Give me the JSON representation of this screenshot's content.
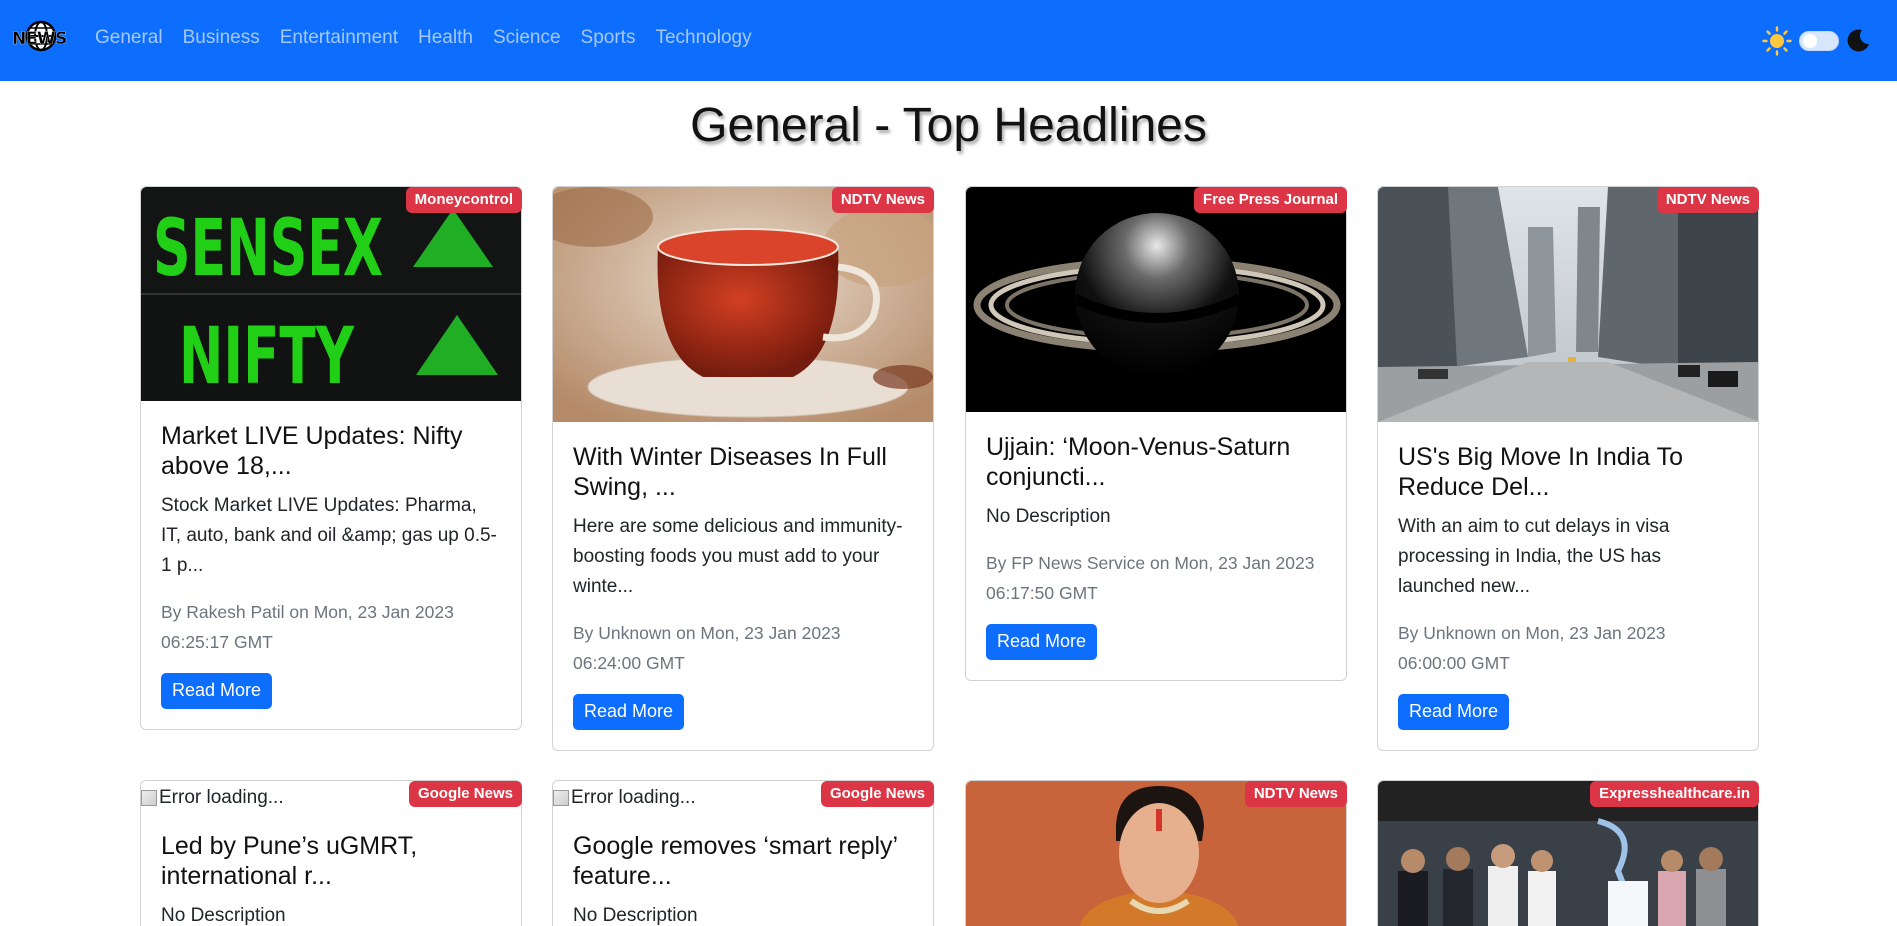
{
  "navbar": {
    "logo_text": "NEWS",
    "links": [
      "General",
      "Business",
      "Entertainment",
      "Health",
      "Science",
      "Sports",
      "Technology"
    ],
    "theme_toggle": {
      "sun_icon": "sun-icon",
      "moon_icon": "moon-icon"
    }
  },
  "page_title": "General - Top Headlines",
  "colors": {
    "primary": "#0d6efd",
    "badge": "#dc3545",
    "meta": "#6c757d"
  },
  "cards": [
    {
      "source": "Moneycontrol",
      "title": "Market LIVE Updates: Nifty above 18,...",
      "description": "Stock Market LIVE Updates: Pharma, IT, auto, bank and oil &amp; gas up 0.5-1 p...",
      "meta": "By Rakesh Patil on Mon, 23 Jan 2023 06:25:17 GMT",
      "button": "Read More",
      "image": "sensex-nifty"
    },
    {
      "source": "NDTV News",
      "title": "With Winter Diseases In Full Swing, ...",
      "description": "Here are some delicious and immunity-boosting foods you must add to your winte...",
      "meta": "By Unknown on Mon, 23 Jan 2023 06:24:00 GMT",
      "button": "Read More",
      "image": "tea-cup"
    },
    {
      "source": "Free Press Journal",
      "title": "Ujjain: ‘Moon-Venus-Saturn conjuncti...",
      "description": "No Description",
      "meta": "By FP News Service on Mon, 23 Jan 2023 06:17:50 GMT",
      "button": "Read More",
      "image": "saturn"
    },
    {
      "source": "NDTV News",
      "title": "US's Big Move In India To Reduce Del...",
      "description": "With an aim to cut delays in visa processing in India, the US has launched new...",
      "meta": "By Unknown on Mon, 23 Jan 2023 06:00:00 GMT",
      "button": "Read More",
      "image": "city-street"
    },
    {
      "source": "Google News",
      "image_alt": "Error loading...",
      "title": "Led by Pune’s uGMRT, international r...",
      "description": "No Description"
    },
    {
      "source": "Google News",
      "image_alt": "Error loading...",
      "title": "Google removes ‘smart reply’ feature...",
      "description": "No Description"
    },
    {
      "source": "NDTV News",
      "image": "portrait"
    },
    {
      "source": "Expresshealthcare.in",
      "image": "group-photo"
    }
  ]
}
